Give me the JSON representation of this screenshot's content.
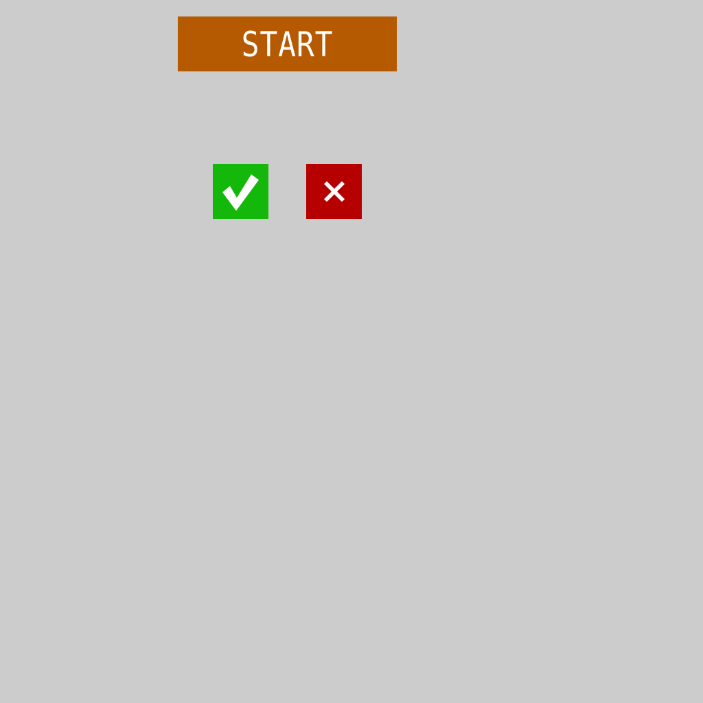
{
  "start_button": {
    "label": "START"
  },
  "controls": {
    "confirm_icon": "check-icon",
    "cancel_icon": "close-icon"
  },
  "colors": {
    "background": "#cccccc",
    "start_button": "#b55a00",
    "confirm_button": "#14b80a",
    "cancel_button": "#b60000",
    "foreground": "#ffffff"
  }
}
